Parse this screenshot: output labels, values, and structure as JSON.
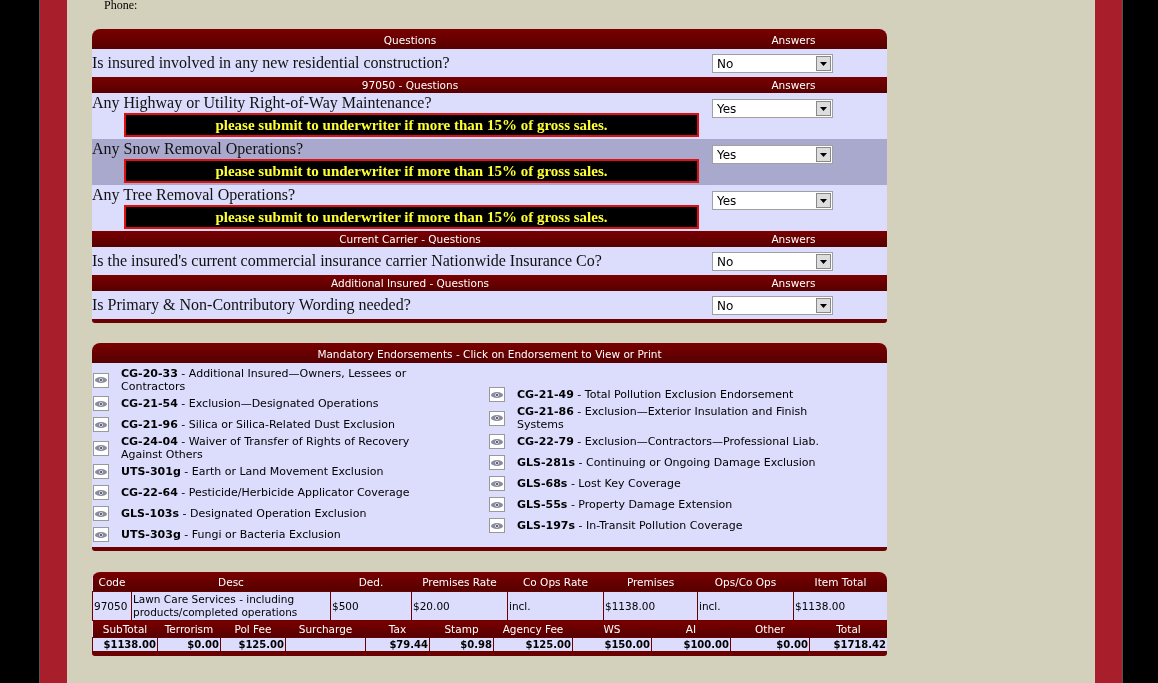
{
  "phone_label": "Phone:",
  "question_sections": [
    {
      "title": "Questions",
      "answers_header": "Answers",
      "questions": [
        {
          "text": "Is insured involved in any new residential construction?",
          "answer": "No",
          "highlighted": false
        }
      ]
    },
    {
      "title": "97050 - Questions",
      "answers_header": "Answers",
      "questions": [
        {
          "text": "Any Highway or Utility Right-of-Way Maintenance?",
          "answer": "Yes",
          "highlighted": false,
          "warning": "please submit to underwriter if more than 15% of gross sales."
        },
        {
          "text": "Any Snow Removal Operations?",
          "answer": "Yes",
          "highlighted": true,
          "warning": "please submit to underwriter if more than 15% of gross sales."
        },
        {
          "text": "Any Tree Removal Operations?",
          "answer": "Yes",
          "highlighted": false,
          "warning": "please submit to underwriter if more than 15% of gross sales."
        }
      ]
    },
    {
      "title": "Current Carrier - Questions",
      "answers_header": "Answers",
      "questions": [
        {
          "text": "Is the insured's current commercial insurance carrier Nationwide Insurance Co?",
          "answer": "No",
          "highlighted": false
        }
      ]
    },
    {
      "title": "Additional Insured - Questions",
      "answers_header": "Answers",
      "questions": [
        {
          "text": "Is Primary & Non-Contributory Wording needed?",
          "answer": "No",
          "highlighted": false
        }
      ]
    }
  ],
  "endorsements": {
    "title": "Mandatory Endorsements - Click on Endorsement to View or Print",
    "columns": [
      [
        "**CG-20-33** - Additional Insured—Owners, Lessees or Contractors",
        "**CG-21-54** - Exclusion—Designated Operations",
        "**CG-21-96** - Silica or Silica-Related Dust Exclusion",
        "**CG-24-04** - Waiver of Transfer of Rights of Recovery Against Others",
        "**UTS-301g** - Earth or Land Movement Exclusion",
        "**CG-22-64** - Pesticide/Herbicide Applicator Coverage",
        "**GLS-103s** - Designated Operation Exclusion",
        "**UTS-303g** - Fungi or Bacteria Exclusion"
      ],
      [
        "**CG-21-49** - Total Pollution Exclusion Endorsement",
        "**CG-21-86** - Exclusion—Exterior Insulation and Finish Systems",
        "**CG-22-79** - Exclusion—Contractors—Professional Liab.",
        "**GLS-281s** - Continuing or Ongoing Damage Exclusion",
        "**GLS-68s** - Lost Key Coverage",
        "**GLS-55s** - Property Damage Extension",
        "**GLS-197s** - In-Transit Pollution Coverage"
      ]
    ]
  },
  "cost_table": {
    "columns": [
      "Code",
      "Desc",
      "Ded.",
      "Premises Rate",
      "Co Ops Rate",
      "Premises",
      "Ops/Co Ops",
      "Item Total"
    ],
    "rows": [
      [
        "97050",
        "Lawn Care Services - including products/completed operations",
        "$500",
        "$20.00",
        "incl.",
        "$1138.00",
        "incl.",
        "$1138.00"
      ]
    ],
    "totals": [
      {
        "label": "SubTotal",
        "value": "$1138.00"
      },
      {
        "label": "Terrorism",
        "value": "$0.00"
      },
      {
        "label": "Pol Fee",
        "value": "$125.00"
      },
      {
        "label": "Surcharge"
      },
      {
        "label": "Tax",
        "value": "$79.44"
      },
      {
        "label": "Stamp",
        "value": "$0.98"
      },
      {
        "label": "Agency Fee",
        "value": "$125.00"
      },
      {
        "label": "WS",
        "value": "$150.00"
      },
      {
        "label": "AI",
        "value": "$100.00"
      },
      {
        "label": "Other",
        "value": "$0.00"
      },
      {
        "label": "Total",
        "value": "$1718.42"
      }
    ]
  }
}
